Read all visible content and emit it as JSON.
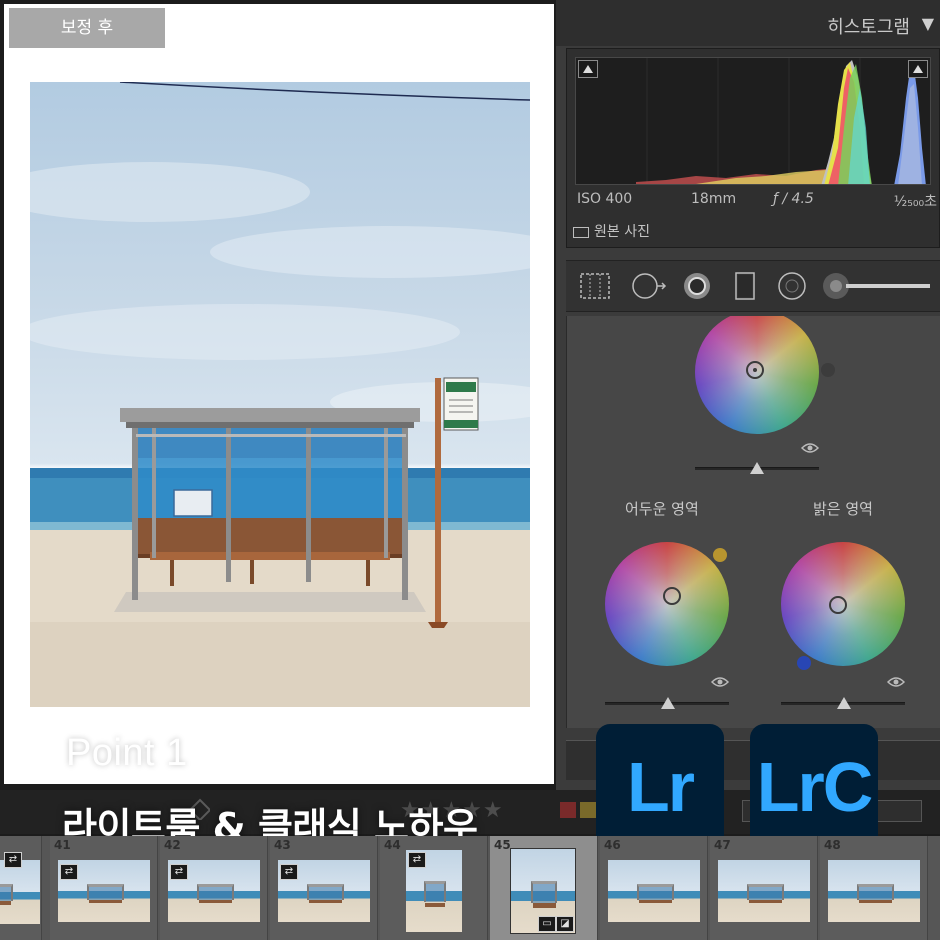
{
  "preview": {
    "view_label": "보정 후",
    "point_label": "Point 1"
  },
  "histogram": {
    "title": "히스토그램",
    "arrow": "▼",
    "exif": {
      "iso": "ISO 400",
      "focal": "18mm",
      "aperture": "ƒ / 4.5",
      "shutter": "¹⁄₂₅₀₀초"
    },
    "original_photo_label": "원본 사진"
  },
  "color_grading": {
    "shadows_label": "어두운 영역",
    "highlights_label": "밝은 영역",
    "midtone_swatch_color": "#3c3c3c",
    "shadows_swatch_color": "#b8952f",
    "highlights_swatch_color": "#2846b4"
  },
  "headline": "라이트룸 & 클래식 노하우",
  "logos": {
    "lr": "Lr",
    "lrc": "LrC",
    "bg_color": "#001e36",
    "text_color": "#31a8ff"
  },
  "toolbar": {
    "stars": "★★★★★",
    "label_colors": [
      "#8a2a2a",
      "#8a7a2a",
      "#3a6a3a",
      "#2a4a7a",
      "#5a3a6a"
    ]
  },
  "filmstrip": {
    "cells": [
      {
        "number": "",
        "active": false
      },
      {
        "number": "41",
        "active": false
      },
      {
        "number": "42",
        "active": false
      },
      {
        "number": "43",
        "active": false
      },
      {
        "number": "44",
        "active": false
      },
      {
        "number": "45",
        "active": true
      },
      {
        "number": "46",
        "active": false
      },
      {
        "number": "47",
        "active": false
      },
      {
        "number": "48",
        "active": false
      }
    ]
  }
}
